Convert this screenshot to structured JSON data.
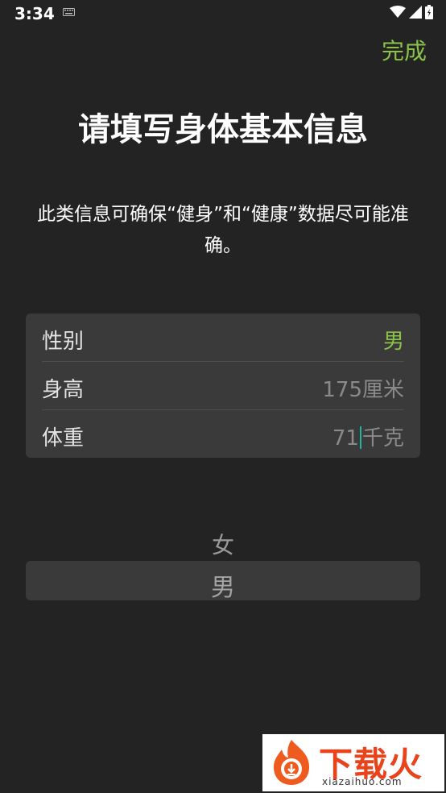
{
  "status_bar": {
    "time": "3:34"
  },
  "header": {
    "done_label": "完成"
  },
  "title": "请填写身体基本信息",
  "description": "此类信息可确保“健身”和“健康”数据尽可能准确。",
  "form": {
    "gender": {
      "label": "性别",
      "value": "男"
    },
    "height": {
      "label": "身高",
      "value": "175厘米"
    },
    "weight": {
      "label": "体重",
      "value_before_cursor": "71",
      "value_after_cursor": "千克"
    }
  },
  "picker": {
    "options": [
      "女",
      "男"
    ],
    "selected": "男"
  },
  "watermark": {
    "brand": "下载火",
    "url": "xiazaihuo.com"
  },
  "colors": {
    "accent": "#8bc34a",
    "cursor": "#1fb6a0",
    "background": "#232323",
    "card": "#3a3a3a"
  },
  "icons": [
    "keyboard-icon",
    "wifi-icon",
    "signal-icon",
    "battery-icon"
  ]
}
